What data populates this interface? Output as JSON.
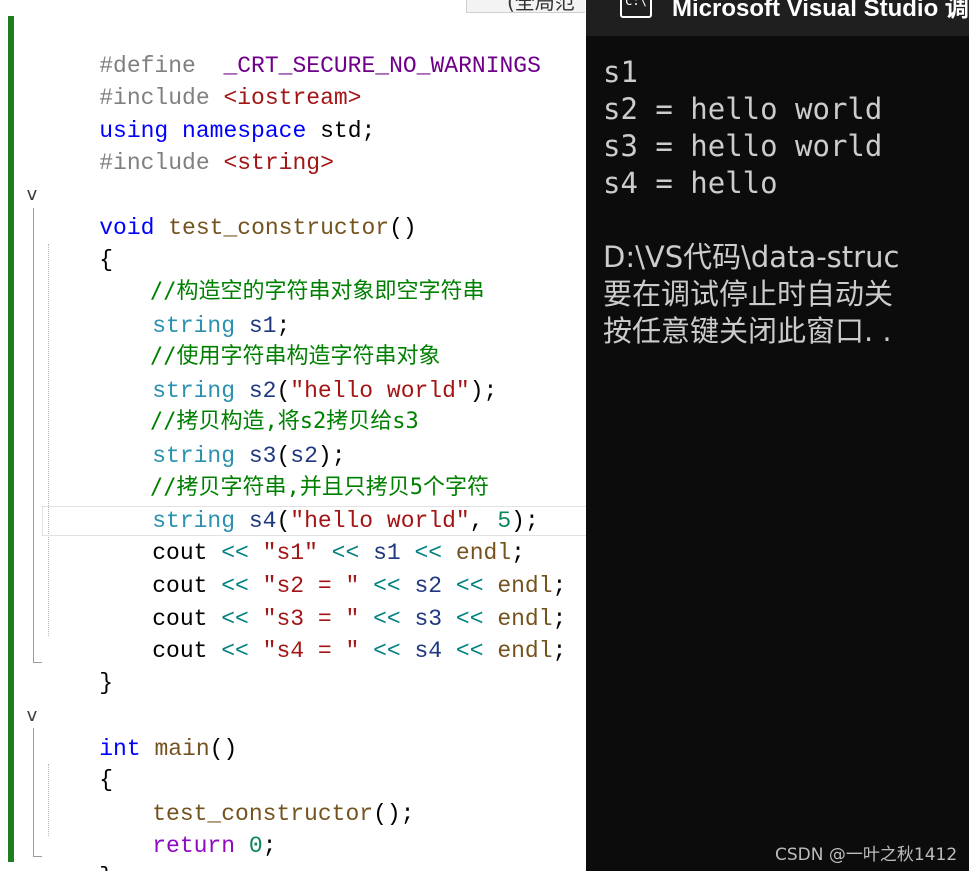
{
  "editor": {
    "lines": {
      "l1": {
        "a": "#define",
        "b": "  _CRT_SECURE_NO_WARNINGS"
      },
      "l2": {
        "a": "#include ",
        "b": "<iostream>"
      },
      "l3": {
        "a": "using",
        "b": " ",
        "c": "namespace",
        "d": " std;"
      },
      "l4": {
        "a": "#include ",
        "b": "<string>"
      },
      "l6": {
        "a": "void",
        "b": " ",
        "c": "test_constructor",
        "d": "()"
      },
      "l7": {
        "a": "{"
      },
      "l8": {
        "a": "//构造空的字符串对象即空字符串"
      },
      "l9": {
        "a": "string",
        "b": " ",
        "c": "s1",
        "d": ";"
      },
      "l10": {
        "a": "//使用字符串构造字符串对象"
      },
      "l11": {
        "a": "string",
        "b": " ",
        "c": "s2",
        "d": "(",
        "e": "\"hello world\"",
        "f": ");"
      },
      "l12": {
        "a": "//拷贝构造,将s2拷贝给s3"
      },
      "l13": {
        "a": "string",
        "b": " ",
        "c": "s3",
        "d": "(",
        "e": "s2",
        "f": ");"
      },
      "l14": {
        "a": "//拷贝字符串,并且只拷贝5个字符"
      },
      "l15": {
        "a": "string",
        "b": " ",
        "c": "s4",
        "d": "(",
        "e": "\"hello world\"",
        "f": ", ",
        "g": "5",
        "h": ");"
      },
      "l16": {
        "a": "cout",
        "b": " << ",
        "c": "\"s1\"",
        "d": " << ",
        "e": "s1",
        "f": " << ",
        "g": "endl",
        "h": ";"
      },
      "l17": {
        "a": "cout",
        "b": " << ",
        "c": "\"s2 = \"",
        "d": " << ",
        "e": "s2",
        "f": " << ",
        "g": "endl",
        "h": ";"
      },
      "l18": {
        "a": "cout",
        "b": " << ",
        "c": "\"s3 = \"",
        "d": " << ",
        "e": "s3",
        "f": " << ",
        "g": "endl",
        "h": ";"
      },
      "l19": {
        "a": "cout",
        "b": " << ",
        "c": "\"s4 = \"",
        "d": " << ",
        "e": "s4",
        "f": " << ",
        "g": "endl",
        "h": ";"
      },
      "l20": {
        "a": "}"
      },
      "l22": {
        "a": "int",
        "b": " ",
        "c": "main",
        "d": "()"
      },
      "l23": {
        "a": "{"
      },
      "l24": {
        "a": "test_constructor",
        "b": "();"
      },
      "l25": {
        "a": "return",
        "b": " ",
        "c": "0",
        "d": ";"
      },
      "l26": {
        "a": "}"
      }
    },
    "fold_glyph": "v",
    "colors": {
      "keyword": "#0000ff",
      "type": "#2b91af",
      "string": "#a31515",
      "comment": "#008000",
      "change_bar": "#1e7d1e"
    }
  },
  "top_tab": {
    "text": "(全局范"
  },
  "console": {
    "title": "Microsoft Visual Studio 调",
    "icon_text": "C:\\",
    "output": [
      "s1",
      "s2 = hello world",
      "s3 = hello world",
      "s4 = hello",
      "",
      "D:\\VS代码\\data-struc",
      "要在调试停止时自动关",
      "按任意键关闭此窗口. ."
    ],
    "background": "#0c0c0c"
  },
  "watermark": "CSDN @一叶之秋1412"
}
